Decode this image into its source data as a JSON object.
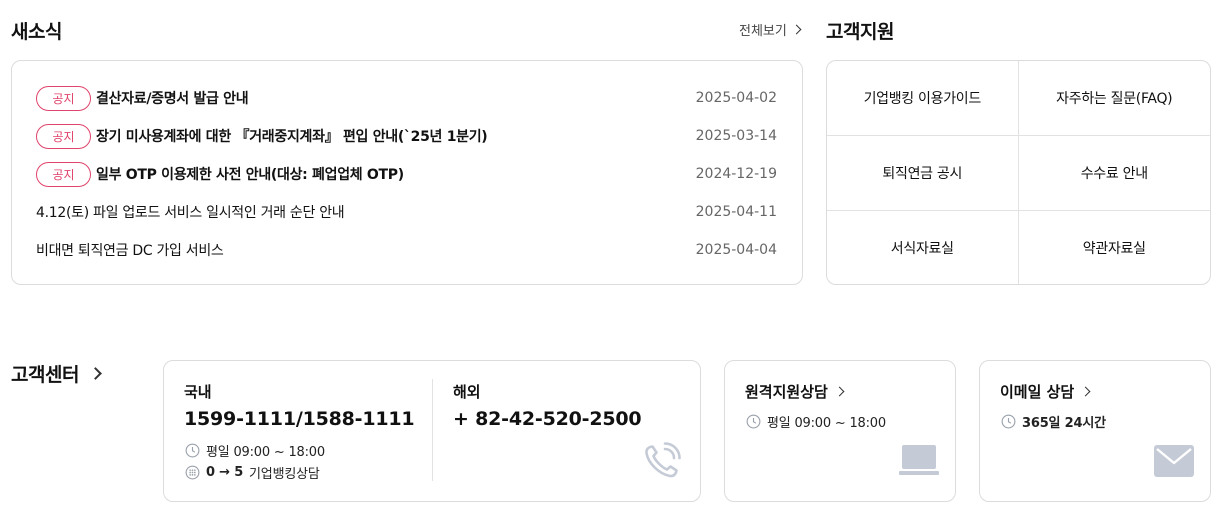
{
  "news": {
    "title": "새소식",
    "view_all": "전체보기",
    "items": [
      {
        "badge": "공지",
        "title": "결산자료/증명서 발급 안내",
        "date": "2025-04-02"
      },
      {
        "badge": "공지",
        "title": "장기 미사용계좌에 대한 『거래중지계좌』 편입 안내(`25년 1분기)",
        "date": "2025-03-14"
      },
      {
        "badge": "공지",
        "title": "일부 OTP 이용제한 사전 안내(대상: 폐업업체 OTP)",
        "date": "2024-12-19"
      },
      {
        "badge": "",
        "title": "4.12(토) 파일 업로드 서비스 일시적인 거래 순단 안내",
        "date": "2025-04-11"
      },
      {
        "badge": "",
        "title": "비대면 퇴직연금 DC 가입 서비스",
        "date": "2025-04-04"
      }
    ]
  },
  "support": {
    "title": "고객지원",
    "items": [
      "기업뱅킹 이용가이드",
      "자주하는 질문(FAQ)",
      "퇴직연금 공시",
      "수수료 안내",
      "서식자료실",
      "약관자료실"
    ]
  },
  "center": {
    "title": "고객센터",
    "domestic": {
      "label": "국내",
      "phone": "1599-1111/1588-1111",
      "hours": "평일 09:00 ~ 18:00",
      "ars_key": "0 → 5",
      "ars_desc": "기업뱅킹상담"
    },
    "overseas": {
      "label": "해외",
      "phone": "+ 82-42-520-2500"
    },
    "remote": {
      "label": "원격지원상담",
      "hours": "평일 09:00 ~ 18:00"
    },
    "email": {
      "label": "이메일 상담",
      "hours_num": "365",
      "hours_rest": "일 24시간"
    }
  },
  "colors": {
    "badge": "#e0436b",
    "icon_gray": "#c5cbd6",
    "border": "#dcdcdc"
  }
}
